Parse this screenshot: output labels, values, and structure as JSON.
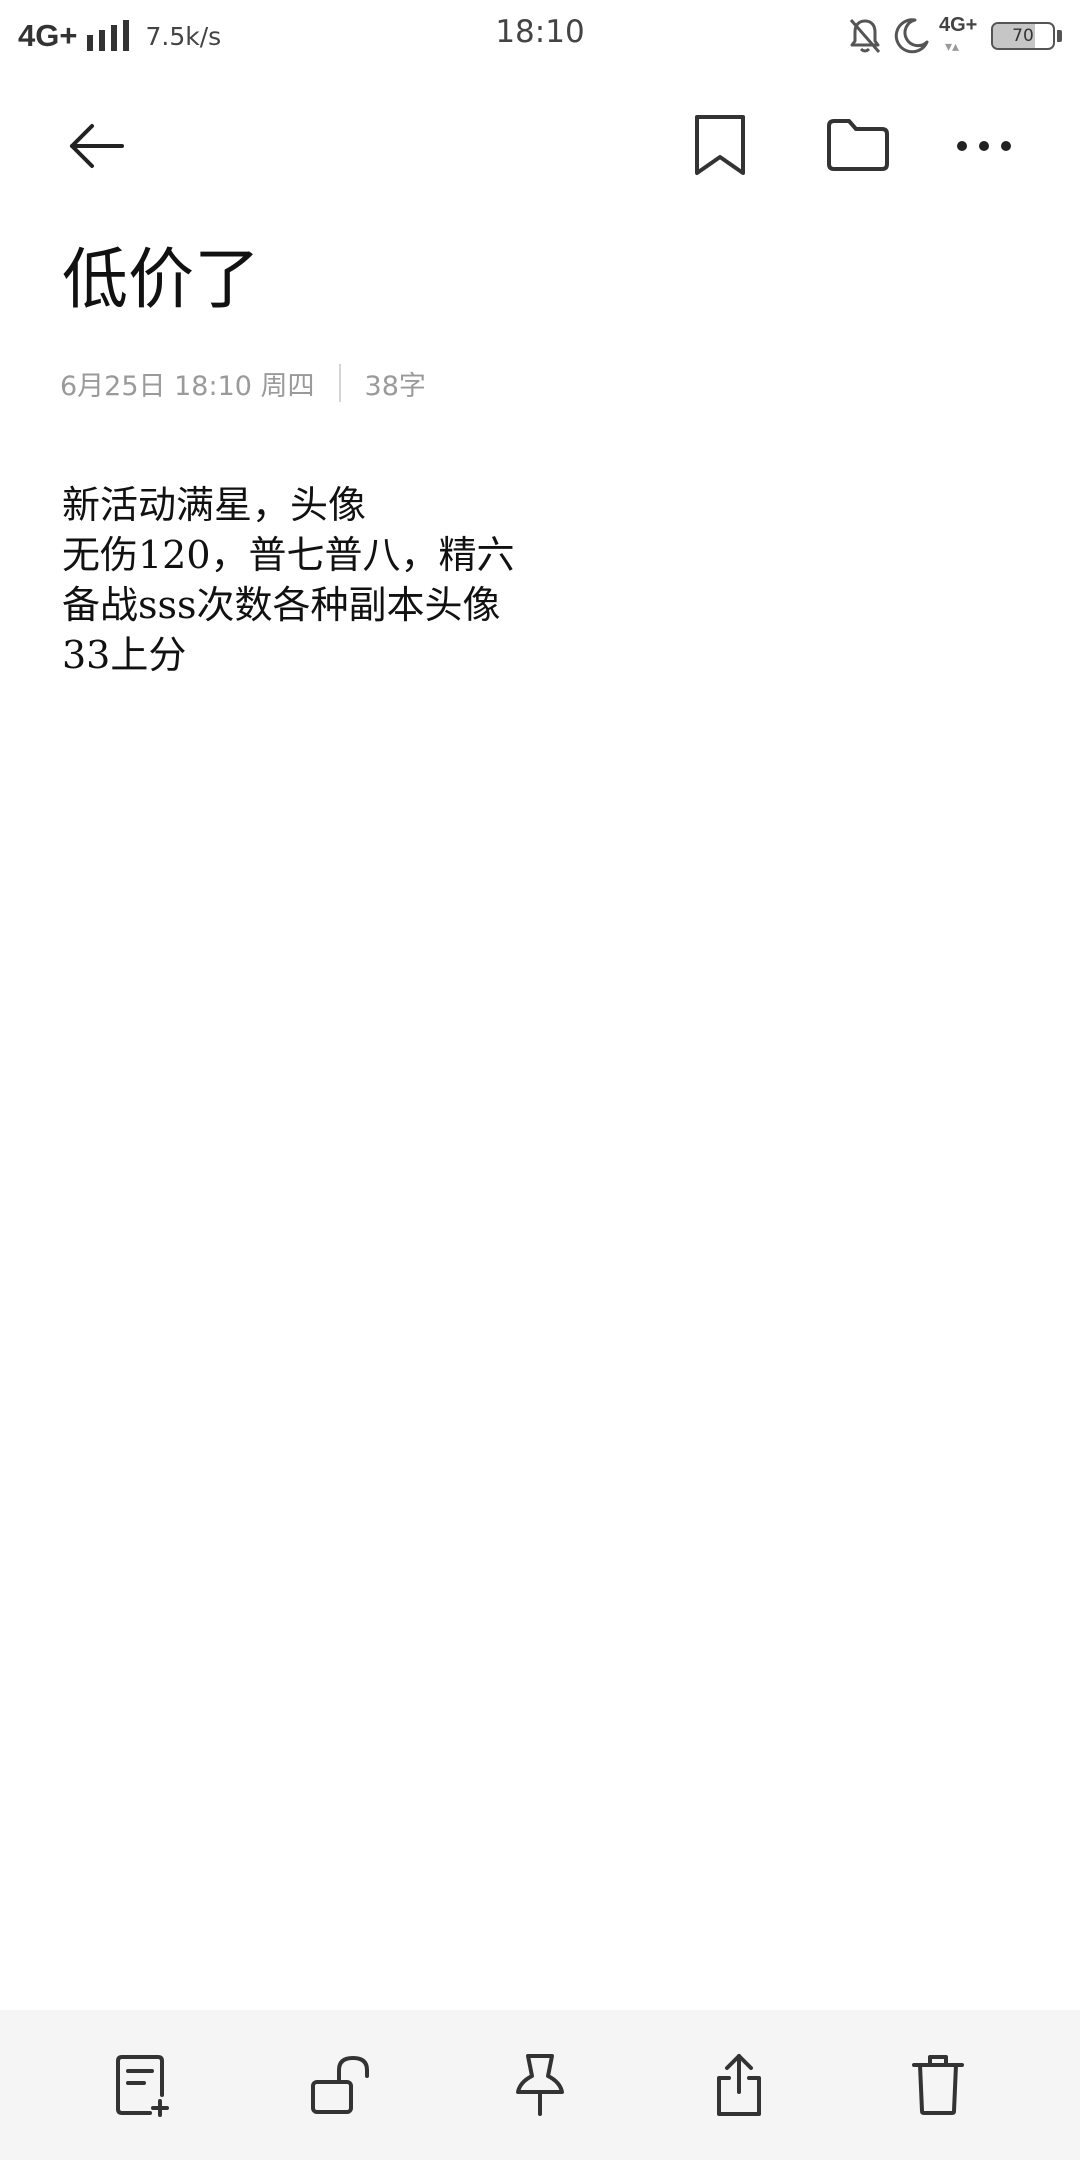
{
  "status_bar": {
    "network": "4G+",
    "speed": "7.5k/s",
    "time": "18:10",
    "network_secondary": "4G+",
    "network_secondary_arrows": "▾▴",
    "battery_level": "70",
    "battery_fraction": 0.7
  },
  "toolbar": {
    "icons": [
      "back-arrow-icon",
      "bookmark-icon",
      "folder-icon",
      "more-dots-icon"
    ]
  },
  "note": {
    "title": "低价了",
    "date": "6月25日 18:10 周四",
    "word_count": "38字",
    "lines": [
      "新活动满星，头像",
      "无伤120，普七普八，精六",
      "备战sss次数各种副本头像",
      "33上分"
    ]
  },
  "bottom_bar": {
    "icons": [
      "new-note-icon",
      "unlock-icon",
      "pin-icon",
      "share-icon",
      "trash-icon"
    ]
  },
  "colors": {
    "text": "#111111",
    "meta": "#9a9a9a",
    "bottom_bar_bg": "#f5f5f5",
    "icon": "#333333"
  }
}
